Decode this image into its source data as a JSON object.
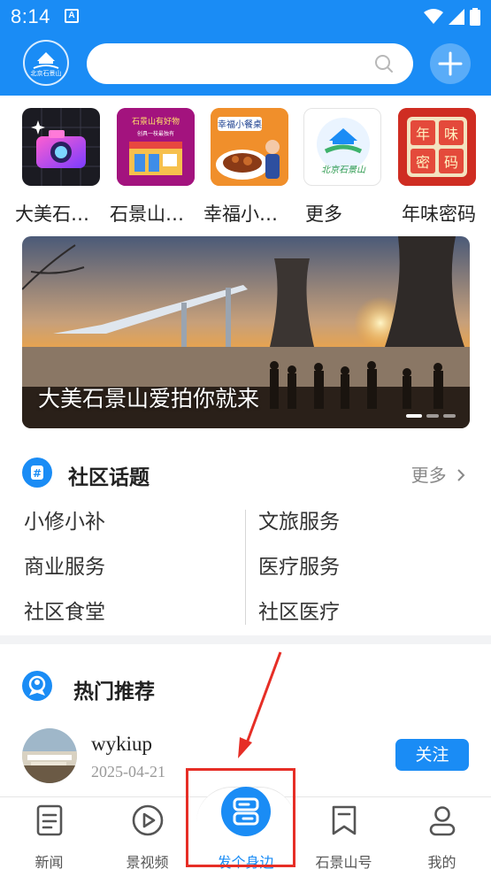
{
  "status_bar": {
    "time": "8:14",
    "indicator": "A"
  },
  "header": {
    "logo_text": "北京石景山",
    "search": {
      "placeholder": ""
    },
    "search_icon": "search-icon",
    "plus_icon": "plus-icon"
  },
  "shortcuts": [
    {
      "label": "大美石…",
      "art": "camera"
    },
    {
      "label": "石景山…",
      "art_text": "石景山有好物",
      "art_sub": "创具一枝最独有"
    },
    {
      "label": "幸福小…",
      "art_text": "幸福小餐桌"
    },
    {
      "label": "更多",
      "art_text": "北京石景山"
    },
    {
      "label": "年味密码",
      "art_chars": [
        "年",
        "味",
        "密",
        "码"
      ]
    }
  ],
  "banner": {
    "caption": "大美石景山爱拍你就来",
    "dots": 3,
    "active_dot": 0
  },
  "community": {
    "title": "社区话题",
    "more": "更多",
    "topics_left": [
      "小修小补",
      "商业服务",
      "社区食堂"
    ],
    "topics_right": [
      "文旅服务",
      "医疗服务",
      "社区医疗"
    ]
  },
  "hot": {
    "title": "热门推荐",
    "user": {
      "name": "wykiup",
      "date": "2025-04-21",
      "follow_label": "关注"
    }
  },
  "bottom_nav": [
    {
      "label": "新闻",
      "icon": "news-icon"
    },
    {
      "label": "景视频",
      "icon": "video-icon"
    },
    {
      "label": "发个身边",
      "icon": "post-icon",
      "active": true
    },
    {
      "label": "石景山号",
      "icon": "bookmark-icon"
    },
    {
      "label": "我的",
      "icon": "profile-icon"
    }
  ],
  "colors": {
    "brand": "#1a8cf5",
    "highlight": "#e62e26"
  }
}
